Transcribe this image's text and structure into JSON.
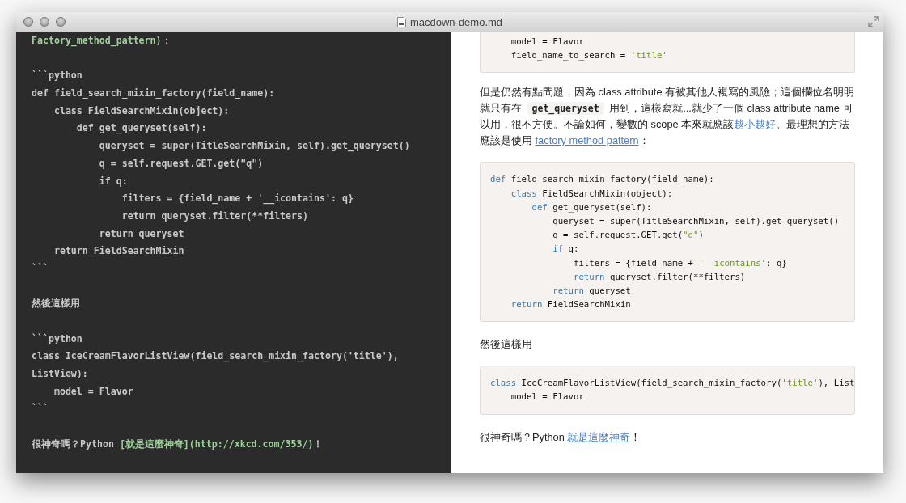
{
  "window": {
    "title": "macdown-demo.md"
  },
  "editor": {
    "blocks": [
      {
        "lines": [
          [
            {
              "text": "Factory_method_pattern)",
              "kind": "link"
            },
            {
              "text": "：",
              "kind": "plain"
            }
          ]
        ]
      },
      {
        "lines": [
          [
            {
              "text": "```python",
              "kind": "plain"
            }
          ],
          [
            {
              "text": "def field_search_mixin_factory(field_name):",
              "kind": "plain"
            }
          ],
          [
            {
              "text": "    class FieldSearchMixin(object):",
              "kind": "plain"
            }
          ],
          [
            {
              "text": "        def get_queryset(self):",
              "kind": "plain"
            }
          ],
          [
            {
              "text": "            queryset = super(TitleSearchMixin, self).get_queryset()",
              "kind": "plain"
            }
          ],
          [
            {
              "text": "            q = self.request.GET.get(\"q\")",
              "kind": "plain"
            }
          ],
          [
            {
              "text": "            if q:",
              "kind": "plain"
            }
          ],
          [
            {
              "text": "                filters = {field_name + '__icontains': q}",
              "kind": "plain"
            }
          ],
          [
            {
              "text": "                return queryset.filter(**filters)",
              "kind": "plain"
            }
          ],
          [
            {
              "text": "            return queryset",
              "kind": "plain"
            }
          ],
          [
            {
              "text": "    return FieldSearchMixin",
              "kind": "plain"
            }
          ],
          [
            {
              "text": "```",
              "kind": "plain"
            }
          ]
        ]
      },
      {
        "lines": [
          [
            {
              "text": "然後這樣用",
              "kind": "plain"
            }
          ]
        ]
      },
      {
        "lines": [
          [
            {
              "text": "```python",
              "kind": "plain"
            }
          ],
          [
            {
              "text": "class IceCreamFlavorListView(field_search_mixin_factory('title'),",
              "kind": "plain"
            }
          ],
          [
            {
              "text": "ListView):",
              "kind": "plain"
            }
          ],
          [
            {
              "text": "    model = Flavor",
              "kind": "plain"
            }
          ],
          [
            {
              "text": "```",
              "kind": "plain"
            }
          ]
        ]
      },
      {
        "lines": [
          [
            {
              "text": "很神奇嗎？Python ",
              "kind": "plain"
            },
            {
              "text": "[就是這麼神奇](http://xkcd.com/353/)",
              "kind": "link"
            },
            {
              "text": "！",
              "kind": "plain"
            }
          ]
        ]
      }
    ]
  },
  "preview": {
    "blocks": [
      {
        "kind": "code",
        "clipped": true,
        "lines": [
          [
            {
              "text": "    model = Flavor",
              "kind": "plain"
            }
          ],
          [
            {
              "text": "    field_name_to_search = ",
              "kind": "plain"
            },
            {
              "text": "'title'",
              "kind": "str"
            }
          ]
        ]
      },
      {
        "kind": "paragraph",
        "segments": [
          {
            "text": "但是仍然有點問題，因為 class attribute 有被其他人複寫的風險；這個欄位名明明就只有在 ",
            "kind": "plain"
          },
          {
            "text": "get_queryset",
            "kind": "code"
          },
          {
            "text": " 用到，這樣寫就...就少了一個 class attribute name 可以用，很不方便。不論如何，變數的 scope 本來就應該",
            "kind": "plain"
          },
          {
            "text": "越小越好",
            "kind": "link"
          },
          {
            "text": "。最理想的方法應該是使用 ",
            "kind": "plain"
          },
          {
            "text": "factory method pattern",
            "kind": "link"
          },
          {
            "text": "：",
            "kind": "plain"
          }
        ]
      },
      {
        "kind": "code",
        "clipped": false,
        "lines": [
          [
            {
              "text": "def",
              "kind": "kw"
            },
            {
              "text": " field_search_mixin_factory(field_name):",
              "kind": "plain"
            }
          ],
          [
            {
              "text": "    class",
              "kind": "kw"
            },
            {
              "text": " FieldSearchMixin(object):",
              "kind": "plain"
            }
          ],
          [
            {
              "text": "        def",
              "kind": "kw"
            },
            {
              "text": " get_queryset(self):",
              "kind": "plain"
            }
          ],
          [
            {
              "text": "            queryset = super(TitleSearchMixin, self).get_queryset()",
              "kind": "plain"
            }
          ],
          [
            {
              "text": "            q = self.request.GET.get(",
              "kind": "plain"
            },
            {
              "text": "\"q\"",
              "kind": "str"
            },
            {
              "text": ")",
              "kind": "plain"
            }
          ],
          [
            {
              "text": "            if",
              "kind": "kw"
            },
            {
              "text": " q:",
              "kind": "plain"
            }
          ],
          [
            {
              "text": "                filters = {field_name + ",
              "kind": "plain"
            },
            {
              "text": "'__icontains'",
              "kind": "str"
            },
            {
              "text": ": q}",
              "kind": "plain"
            }
          ],
          [
            {
              "text": "                return",
              "kind": "kw"
            },
            {
              "text": " queryset.filter(**filters)",
              "kind": "plain"
            }
          ],
          [
            {
              "text": "            return",
              "kind": "kw"
            },
            {
              "text": " queryset",
              "kind": "plain"
            }
          ],
          [
            {
              "text": "    return",
              "kind": "kw"
            },
            {
              "text": " FieldSearchMixin",
              "kind": "plain"
            }
          ]
        ]
      },
      {
        "kind": "paragraph",
        "segments": [
          {
            "text": "然後這樣用",
            "kind": "plain"
          }
        ]
      },
      {
        "kind": "code",
        "clipped": false,
        "lines": [
          [
            {
              "text": "class",
              "kind": "kw"
            },
            {
              "text": " IceCreamFlavorListView(field_search_mixin_factory(",
              "kind": "plain"
            },
            {
              "text": "'title'",
              "kind": "str"
            },
            {
              "text": "), List",
              "kind": "plain"
            }
          ],
          [
            {
              "text": "    model = Flavor",
              "kind": "plain"
            }
          ]
        ]
      },
      {
        "kind": "paragraph",
        "segments": [
          {
            "text": "很神奇嗎？Python ",
            "kind": "plain"
          },
          {
            "text": "就是這麼神奇",
            "kind": "link"
          },
          {
            "text": "！",
            "kind": "plain"
          }
        ]
      }
    ]
  }
}
